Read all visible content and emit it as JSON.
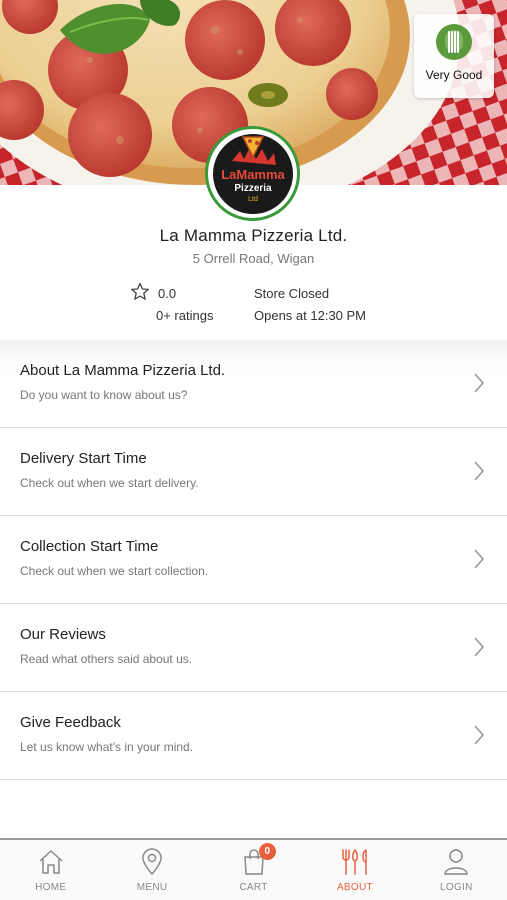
{
  "hero": {
    "hygiene_rating_label": "Very Good",
    "logo": {
      "line1": "LaMamma",
      "line2": "Pizzeria",
      "line3": "Ltd"
    }
  },
  "store": {
    "name": "La Mamma Pizzeria Ltd.",
    "address": "5 Orrell Road, Wigan",
    "rating_value": "0.0",
    "rating_count": "0+ ratings",
    "status": "Store Closed",
    "opens_at": "Opens at 12:30 PM"
  },
  "menu_items": [
    {
      "title": "About La Mamma Pizzeria Ltd.",
      "subtitle": "Do you want to know about us?"
    },
    {
      "title": "Delivery Start Time",
      "subtitle": "Check out when we start delivery."
    },
    {
      "title": "Collection Start Time",
      "subtitle": "Check out when we start collection."
    },
    {
      "title": "Our Reviews",
      "subtitle": "Read what others said about us."
    },
    {
      "title": "Give Feedback",
      "subtitle": "Let us know what's in your mind."
    }
  ],
  "nav": {
    "home": "HOME",
    "menu": "MENU",
    "cart": "CART",
    "cart_count": "0",
    "about": "ABOUT",
    "login": "LOGIN",
    "active": "about"
  },
  "colors": {
    "accent": "#e8603c",
    "hygiene_green": "#5a9a3c",
    "logo_ring": "#3a9a3a"
  }
}
